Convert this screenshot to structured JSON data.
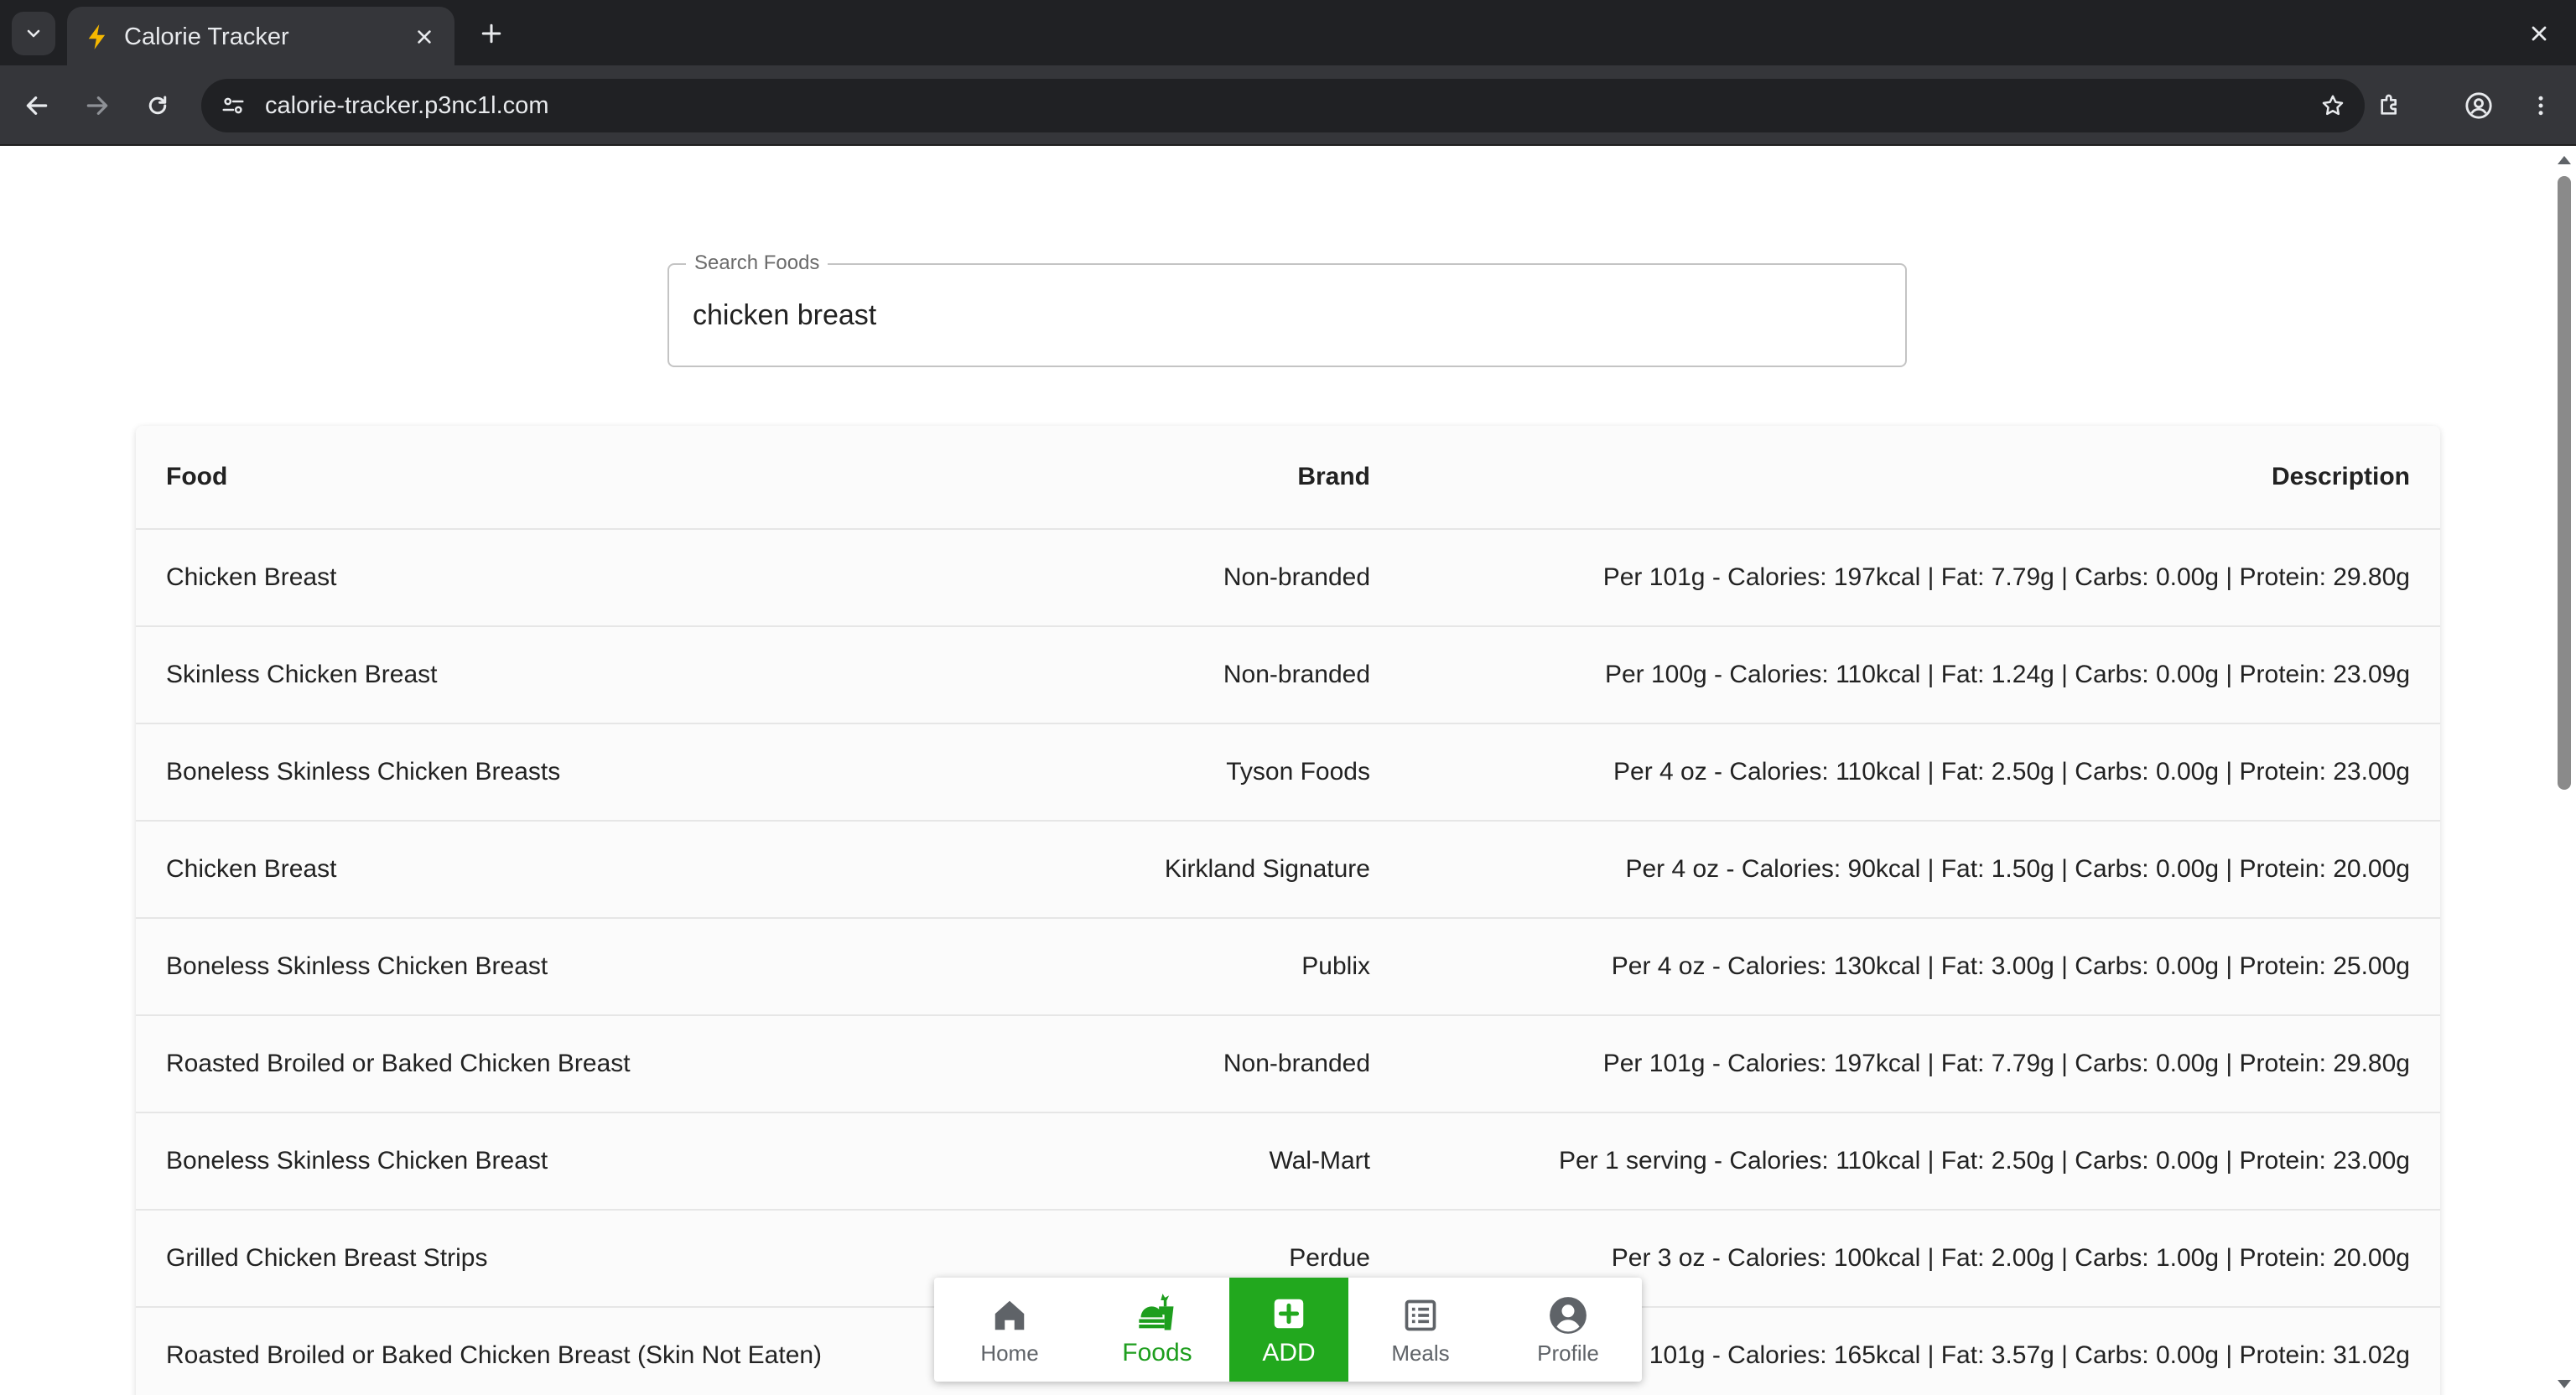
{
  "browser": {
    "tab_title": "Calorie Tracker",
    "url": "calorie-tracker.p3nc1l.com"
  },
  "search": {
    "label": "Search Foods",
    "value": "chicken breast"
  },
  "table": {
    "headers": {
      "food": "Food",
      "brand": "Brand",
      "description": "Description"
    },
    "rows": [
      {
        "food": "Chicken Breast",
        "brand": "Non-branded",
        "description": "Per 101g - Calories: 197kcal | Fat: 7.79g | Carbs: 0.00g | Protein: 29.80g"
      },
      {
        "food": "Skinless Chicken Breast",
        "brand": "Non-branded",
        "description": "Per 100g - Calories: 110kcal | Fat: 1.24g | Carbs: 0.00g | Protein: 23.09g"
      },
      {
        "food": "Boneless Skinless Chicken Breasts",
        "brand": "Tyson Foods",
        "description": "Per 4 oz - Calories: 110kcal | Fat: 2.50g | Carbs: 0.00g | Protein: 23.00g"
      },
      {
        "food": "Chicken Breast",
        "brand": "Kirkland Signature",
        "description": "Per 4 oz - Calories: 90kcal | Fat: 1.50g | Carbs: 0.00g | Protein: 20.00g"
      },
      {
        "food": "Boneless Skinless Chicken Breast",
        "brand": "Publix",
        "description": "Per 4 oz - Calories: 130kcal | Fat: 3.00g | Carbs: 0.00g | Protein: 25.00g"
      },
      {
        "food": "Roasted Broiled or Baked Chicken Breast",
        "brand": "Non-branded",
        "description": "Per 101g - Calories: 197kcal | Fat: 7.79g | Carbs: 0.00g | Protein: 29.80g"
      },
      {
        "food": "Boneless Skinless Chicken Breast",
        "brand": "Wal-Mart",
        "description": "Per 1 serving - Calories: 110kcal | Fat: 2.50g | Carbs: 0.00g | Protein: 23.00g"
      },
      {
        "food": "Grilled Chicken Breast Strips",
        "brand": "Perdue",
        "description": "Per 3 oz - Calories: 100kcal | Fat: 2.00g | Carbs: 1.00g | Protein: 20.00g"
      },
      {
        "food": "Roasted Broiled or Baked Chicken Breast (Skin Not Eaten)",
        "brand": "",
        "description": "Per 101g - Calories: 165kcal | Fat: 3.57g | Carbs: 0.00g | Protein: 31.02g"
      }
    ]
  },
  "bottom_nav": {
    "home": "Home",
    "foods": "Foods",
    "add": "ADD",
    "meals": "Meals",
    "profile": "Profile"
  },
  "colors": {
    "accent": "#22a81e",
    "active_nav": "#1e9e1e",
    "chrome_dark": "#202124",
    "chrome_toolbar": "#35363a"
  },
  "icons": [
    "tab-list-icon",
    "lightning-icon",
    "close-icon",
    "plus-icon",
    "back-icon",
    "forward-icon",
    "reload-icon",
    "site-info-icon",
    "star-icon",
    "extensions-icon",
    "account-icon",
    "more-icon",
    "home-icon",
    "foods-icon",
    "add-icon",
    "meals-icon",
    "profile-icon"
  ]
}
